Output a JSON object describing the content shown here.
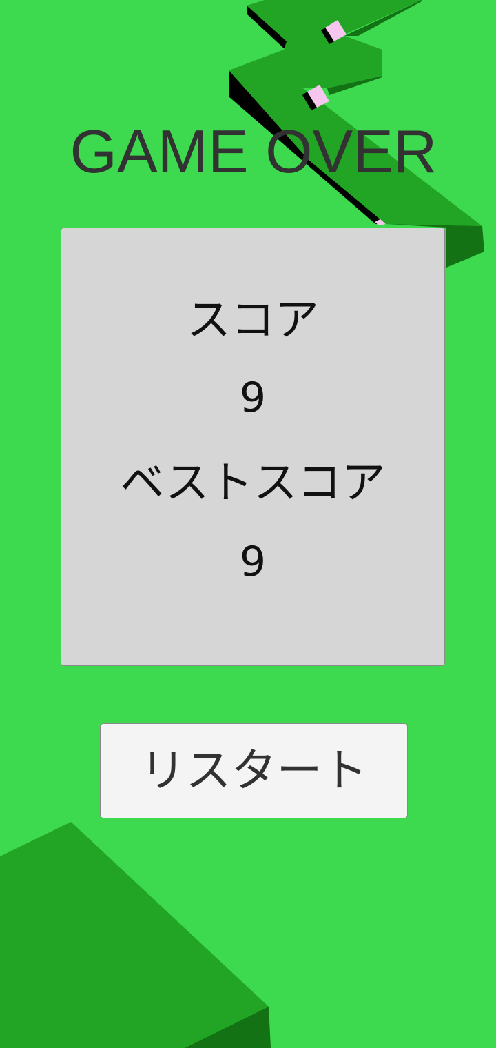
{
  "game": {
    "title": "GAME OVER",
    "score_label": "スコア",
    "score_value": "9",
    "best_score_label": "ベストスコア",
    "best_score_value": "9",
    "restart_label": "リスタート"
  },
  "colors": {
    "background": "#3dd94f",
    "path_top": "#22a425",
    "path_side": "#137213",
    "shadow": "#000000",
    "gem": "#f7c6ee",
    "panel": "#d6d6d6",
    "button": "#f4f4f4",
    "title_text": "#323232"
  }
}
